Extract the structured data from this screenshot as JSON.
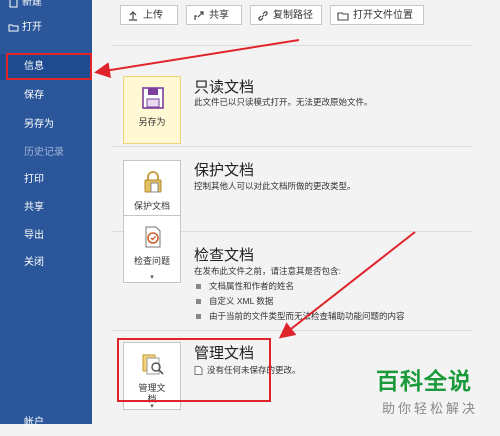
{
  "sidebar": {
    "items": [
      {
        "label": "新建"
      },
      {
        "label": "打开"
      },
      {
        "label": "信息"
      },
      {
        "label": "保存"
      },
      {
        "label": "另存为"
      },
      {
        "label": "历史记录"
      },
      {
        "label": "打印"
      },
      {
        "label": "共享"
      },
      {
        "label": "导出"
      },
      {
        "label": "关闭"
      },
      {
        "label": "帐户"
      }
    ]
  },
  "toolbar": {
    "upload_label": "上传",
    "share_label": "共享",
    "copy_path_label": "复制路径",
    "open_location_label": "打开文件位置"
  },
  "sections": [
    {
      "title": "只读文档",
      "description": "此文件已以只读模式打开。无法更改原始文件。",
      "tile_label": "另存为"
    },
    {
      "title": "保护文档",
      "description": "控制其他人可以对此文档所做的更改类型。",
      "tile_label": "保护文档"
    },
    {
      "title": "检查文档",
      "description": "在发布此文件之前，请注意其是否包含:",
      "bullets": [
        "文档属性和作者的姓名",
        "自定义 XML 数据",
        "由于当前的文件类型而无法检查辅助功能问题的内容"
      ],
      "tile_label": "检查问题"
    },
    {
      "title": "管理文档",
      "description": "没有任何未保存的更改。",
      "tile_label_line1": "管理文",
      "tile_label_line2": "档"
    }
  ],
  "watermark": {
    "big": "百科全说",
    "small": "助你轻松解决"
  },
  "colors": {
    "sidebar": "#2b579a",
    "annotation": "#e0242b",
    "watermark": "#1a9a3a"
  }
}
